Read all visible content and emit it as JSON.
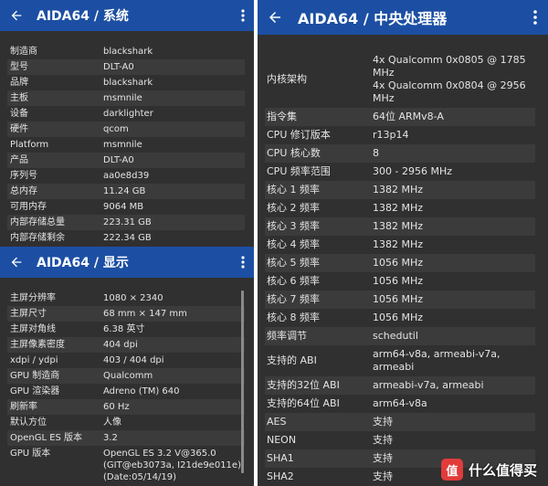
{
  "system_panel": {
    "title": "AIDA64  /  系统",
    "rows": [
      {
        "k": "制造商",
        "v": "blackshark"
      },
      {
        "k": "型号",
        "v": "DLT-A0"
      },
      {
        "k": "品牌",
        "v": "blackshark"
      },
      {
        "k": "主板",
        "v": "msmnile"
      },
      {
        "k": "设备",
        "v": "darklighter"
      },
      {
        "k": "硬件",
        "v": "qcom"
      },
      {
        "k": "Platform",
        "v": "msmnile"
      },
      {
        "k": "产品",
        "v": "DLT-A0"
      },
      {
        "k": "序列号",
        "v": "aa0e8d39"
      },
      {
        "k": "总内存",
        "v": "11.24 GB"
      },
      {
        "k": "可用内存",
        "v": "9064 MB"
      },
      {
        "k": "内部存储总量",
        "v": "223.31 GB"
      },
      {
        "k": "内部存储剩余",
        "v": "222.34 GB"
      }
    ]
  },
  "display_panel": {
    "title": "AIDA64  /  显示",
    "rows": [
      {
        "k": "主屏分辨率",
        "v": "1080 × 2340"
      },
      {
        "k": "主屏尺寸",
        "v": "68 mm × 147 mm"
      },
      {
        "k": "主屏对角线",
        "v": "6.38 英寸"
      },
      {
        "k": "主屏像素密度",
        "v": "404 dpi"
      },
      {
        "k": "xdpi / ydpi",
        "v": "403 / 404 dpi"
      },
      {
        "k": "GPU 制造商",
        "v": "Qualcomm"
      },
      {
        "k": "GPU 渲染器",
        "v": "Adreno (TM) 640"
      },
      {
        "k": "刷新率",
        "v": "60 Hz"
      },
      {
        "k": "默认方位",
        "v": "人像"
      },
      {
        "k": "OpenGL ES 版本",
        "v": "3.2"
      },
      {
        "k": "GPU 版本",
        "v": "OpenGL ES 3.2 V@365.0\n(GIT@eb3073a, I21de9e011e)\n(Date:05/14/19)"
      }
    ]
  },
  "cpu_panel": {
    "title": "AIDA64  /  中央处理器",
    "rows": [
      {
        "k": "内核架构",
        "v": "4x Qualcomm 0x0805 @ 1785\nMHz\n4x Qualcomm 0x0804 @ 2956\nMHz"
      },
      {
        "k": "指令集",
        "v": "64位 ARMv8-A"
      },
      {
        "k": "CPU 修订版本",
        "v": "r13p14"
      },
      {
        "k": "CPU 核心数",
        "v": "8"
      },
      {
        "k": "CPU 频率范围",
        "v": "300 - 2956 MHz"
      },
      {
        "k": "核心 1 频率",
        "v": "1382 MHz"
      },
      {
        "k": "核心 2 频率",
        "v": "1382 MHz"
      },
      {
        "k": "核心 3 频率",
        "v": "1382 MHz"
      },
      {
        "k": "核心 4 频率",
        "v": "1382 MHz"
      },
      {
        "k": "核心 5 频率",
        "v": "1056 MHz"
      },
      {
        "k": "核心 6 频率",
        "v": "1056 MHz"
      },
      {
        "k": "核心 7 频率",
        "v": "1056 MHz"
      },
      {
        "k": "核心 8 频率",
        "v": "1056 MHz"
      },
      {
        "k": "频率调节",
        "v": "schedutil"
      },
      {
        "k": "支持的 ABI",
        "v": "arm64-v8a, armeabi-v7a,\narmeabi"
      },
      {
        "k": "支持的32位 ABI",
        "v": "armeabi-v7a, armeabi"
      },
      {
        "k": "支持的64位 ABI",
        "v": "arm64-v8a"
      },
      {
        "k": "AES",
        "v": "支持"
      },
      {
        "k": "NEON",
        "v": "支持"
      },
      {
        "k": "SHA1",
        "v": "支持"
      },
      {
        "k": "SHA2",
        "v": "支持"
      }
    ]
  },
  "watermark": {
    "badge": "值",
    "text": "什么值得买"
  },
  "icons": {
    "back": "arrow-back-icon",
    "menu": "more-vert-icon"
  },
  "colors": {
    "appbar": "#1c4fa3",
    "panel": "#303030",
    "row_alt": "#3b3b3b",
    "text": "#e4e4e4"
  }
}
